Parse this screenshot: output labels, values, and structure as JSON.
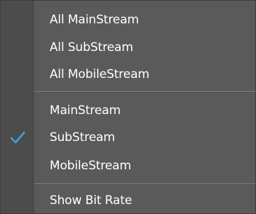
{
  "menu": {
    "items": [
      {
        "label": "All MainStream"
      },
      {
        "label": "All SubStream"
      },
      {
        "label": "All MobileStream"
      },
      {
        "label": "MainStream"
      },
      {
        "label": "SubStream",
        "checked": true
      },
      {
        "label": "MobileStream"
      },
      {
        "label": "Show Bit Rate"
      }
    ]
  },
  "icons": {
    "check": "checkmark-icon"
  },
  "colors": {
    "menu_bg": "#5a5a5a",
    "gutter_bg": "#4c4c4c",
    "text": "#ffffff",
    "check": "#3b9fe0",
    "separator": "#858585"
  }
}
